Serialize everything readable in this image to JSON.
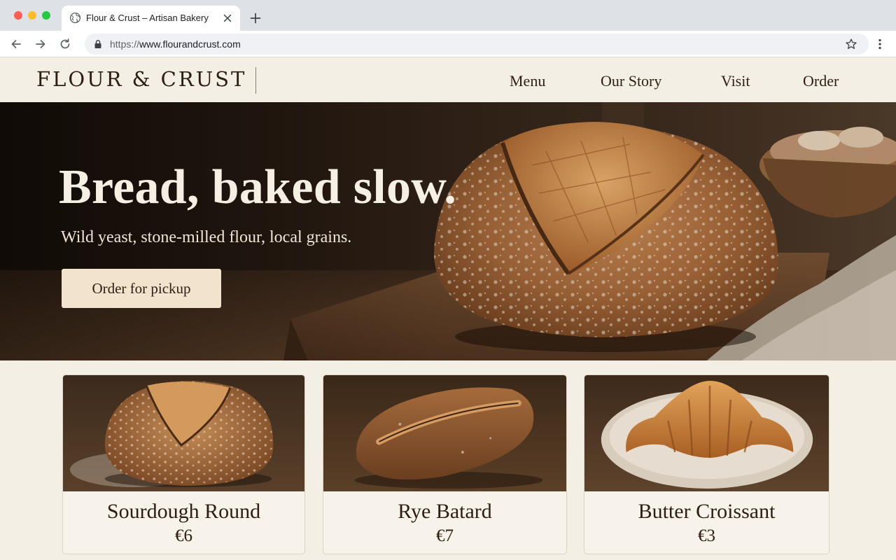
{
  "browser": {
    "tab_title": "Flour & Crust – Artisan Bakery",
    "url_scheme": "https://",
    "url_host": "www.flourandcrust.com",
    "icons": [
      "globe-icon",
      "close-icon",
      "plus-icon",
      "back-arrow-icon",
      "forward-arrow-icon",
      "reload-icon",
      "lock-icon",
      "star-icon",
      "more-vertical-icon"
    ]
  },
  "site": {
    "logo": "FLOUR & CRUST",
    "nav": [
      "Menu",
      "Our Story",
      "Visit",
      "Order"
    ]
  },
  "hero": {
    "title": "Bread, baked slow.",
    "subtitle": "Wild yeast, stone-milled flour, local grains.",
    "cta": "Order for pickup"
  },
  "products": [
    {
      "name": "Sourdough Round",
      "price": "€6"
    },
    {
      "name": "Rye Batard",
      "price": "€7"
    },
    {
      "name": "Butter Croissant",
      "price": "€3"
    }
  ],
  "colors": {
    "page_bg": "#f4efe4",
    "text_dark": "#2c1e14",
    "cta_bg": "#f1e3cc",
    "hero_text": "#f6efe4"
  }
}
